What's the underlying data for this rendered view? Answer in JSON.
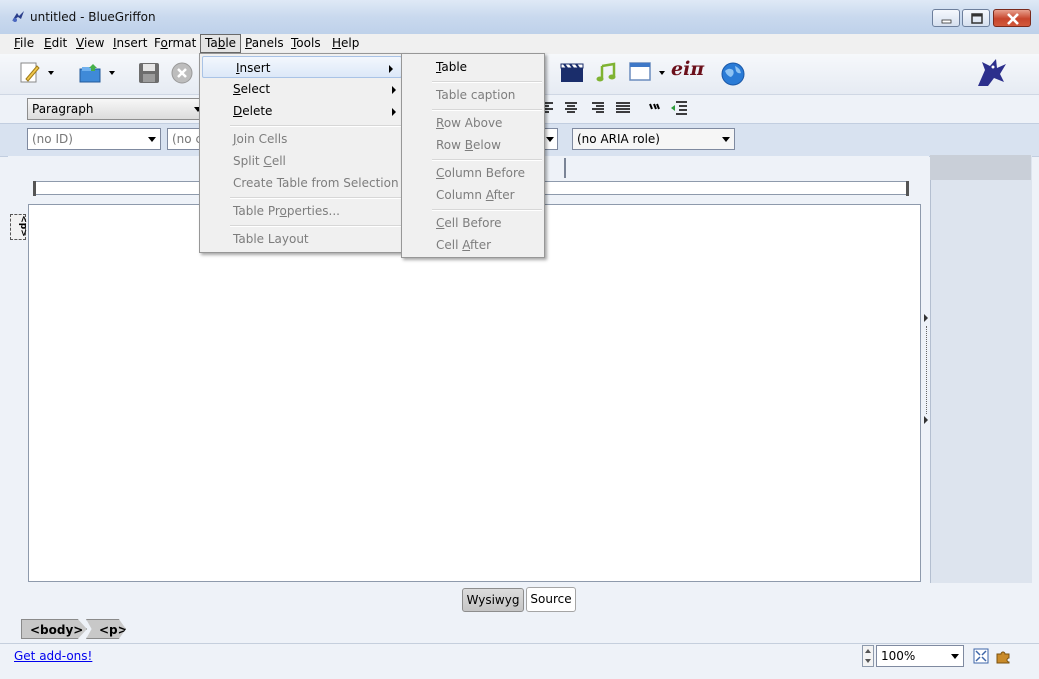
{
  "window": {
    "title": "untitled - BlueGriffon"
  },
  "menubar": [
    {
      "label": "File",
      "accel": "F",
      "rest": "ile"
    },
    {
      "label": "Edit",
      "accel": "E",
      "rest": "dit"
    },
    {
      "label": "View",
      "accel": "V",
      "rest": "iew"
    },
    {
      "label": "Insert",
      "accel": "I",
      "rest": "nsert"
    },
    {
      "label": "Format",
      "pre": "F",
      "accel": "o",
      "rest": "rmat"
    },
    {
      "label": "Table",
      "pre": "Ta",
      "accel": "b",
      "rest": "le"
    },
    {
      "label": "Panels",
      "accel": "P",
      "rest": "anels"
    },
    {
      "label": "Tools",
      "accel": "T",
      "rest": "ools"
    },
    {
      "label": "Help",
      "accel": "H",
      "rest": "elp"
    }
  ],
  "toolbar": {
    "paragraph_select": "Paragraph",
    "id_select": "(no ID)",
    "class_select": "(no c",
    "aria_select": "(no ARIA role)",
    "math_label": "eiπ"
  },
  "editor": {
    "p_tag_label": "<p>"
  },
  "table_menu": {
    "items": [
      {
        "pre": "",
        "accel": "I",
        "rest": "nsert",
        "label": "Insert",
        "submenu": true,
        "disabled": false
      },
      {
        "pre": "",
        "accel": "S",
        "rest": "elect",
        "label": "Select",
        "submenu": true,
        "disabled": false
      },
      {
        "pre": "",
        "accel": "D",
        "rest": "elete",
        "label": "Delete",
        "submenu": true,
        "disabled": false
      },
      {
        "pre": "",
        "accel": "J",
        "rest": "oin Cells",
        "label": "Join Cells",
        "disabled": true
      },
      {
        "pre": "Split ",
        "accel": "C",
        "rest": "ell",
        "label": "Split Cell",
        "disabled": true
      },
      {
        "pre": "Create Table from Selection",
        "accel": "",
        "rest": "",
        "label": "Create Table from Selection",
        "disabled": true
      },
      {
        "pre": "Table Pr",
        "accel": "o",
        "rest": "perties...",
        "label": "Table Properties...",
        "disabled": true
      },
      {
        "pre": "Table Layout",
        "accel": "",
        "rest": "",
        "label": "Table Layout",
        "disabled": true
      }
    ]
  },
  "insert_submenu": {
    "items": [
      {
        "pre": "",
        "accel": "T",
        "rest": "able",
        "label": "Table",
        "disabled": false
      },
      {
        "pre": "Table caption",
        "accel": "",
        "rest": "",
        "label": "Table caption",
        "disabled": true
      },
      {
        "pre": "",
        "accel": "R",
        "rest": "ow Above",
        "label": "Row Above",
        "disabled": true
      },
      {
        "pre": "Row ",
        "accel": "B",
        "rest": "elow",
        "label": "Row Below",
        "disabled": true
      },
      {
        "pre": "",
        "accel": "C",
        "rest": "olumn Before",
        "label": "Column Before",
        "disabled": true
      },
      {
        "pre": "Column ",
        "accel": "A",
        "rest": "fter",
        "label": "Column After",
        "disabled": true
      },
      {
        "pre": "",
        "accel": "C",
        "rest": "ell Before",
        "label": "Cell Before",
        "disabled": true
      },
      {
        "pre": "Cell ",
        "accel": "A",
        "rest": "fter",
        "label": "Cell After",
        "disabled": true
      }
    ]
  },
  "mode_tabs": {
    "wysiwyg": "Wysiwyg",
    "source": "Source"
  },
  "breadcrumb": {
    "body": "<body>",
    "p": "<p>"
  },
  "statusbar": {
    "addons_link": "Get add-ons!",
    "zoom": "100%"
  }
}
